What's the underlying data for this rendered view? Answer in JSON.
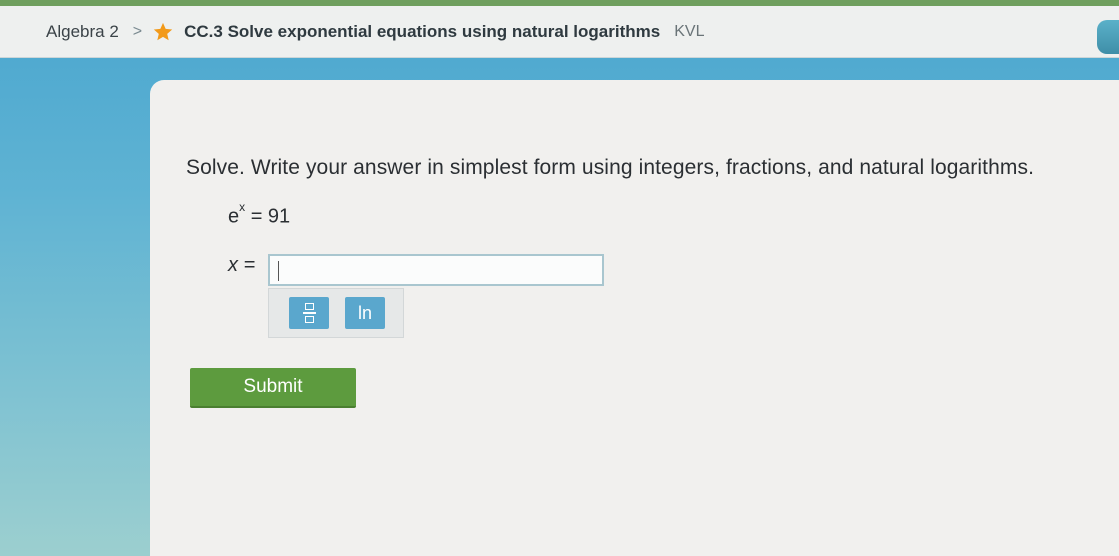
{
  "breadcrumb": {
    "subject": "Algebra 2",
    "separator": ">",
    "skill": "CC.3 Solve exponential equations using natural logarithms",
    "code": "KVL"
  },
  "question": {
    "instructions": "Solve. Write your answer in simplest form using integers, fractions, and natural logarithms.",
    "equation_base": "e",
    "equation_exponent": "x",
    "equation_rhs": "= 91",
    "answer_label": "x =",
    "answer_value": ""
  },
  "toolbar": {
    "fraction_icon": "fraction-icon",
    "ln_label": "ln"
  },
  "submit_label": "Submit",
  "colors": {
    "accent_blue": "#5aa7cd",
    "submit_green": "#5d9b3e",
    "star_orange": "#f29a1a"
  }
}
